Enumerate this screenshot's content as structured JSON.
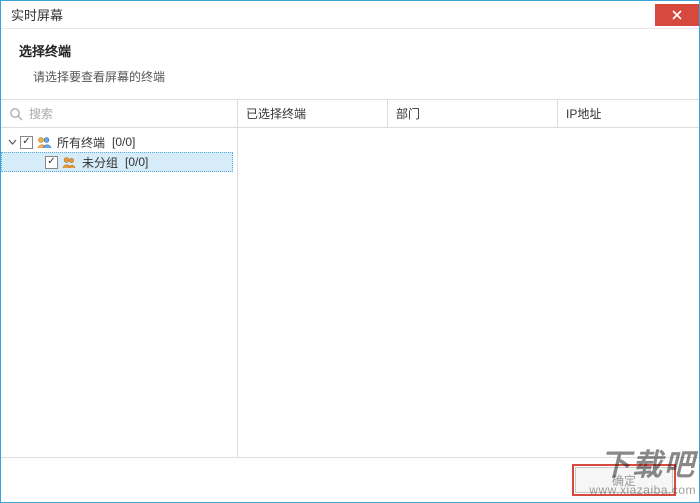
{
  "window": {
    "title": "实时屏幕"
  },
  "header": {
    "title": "选择终端",
    "subtitle": "请选择要查看屏幕的终端"
  },
  "search": {
    "placeholder": "搜索"
  },
  "tree": {
    "root": {
      "label": "所有终端",
      "count": "[0/0]",
      "checked": true,
      "expanded": true
    },
    "child": {
      "label": "未分组",
      "count": "[0/0]",
      "checked": true,
      "selected": true
    }
  },
  "table": {
    "columns": {
      "c1": "已选择终端",
      "c2": "部门",
      "c3": "IP地址"
    }
  },
  "footer": {
    "ok_label": "确定"
  },
  "icons": {
    "group": "group-icon",
    "subgroup": "users-icon"
  },
  "watermark": {
    "text": "下载吧",
    "url": "www.xiazaiba.com"
  },
  "colors": {
    "accent": "#3aa3d9",
    "close_bg": "#d7493d",
    "selection_bg": "#d6ecf9"
  }
}
